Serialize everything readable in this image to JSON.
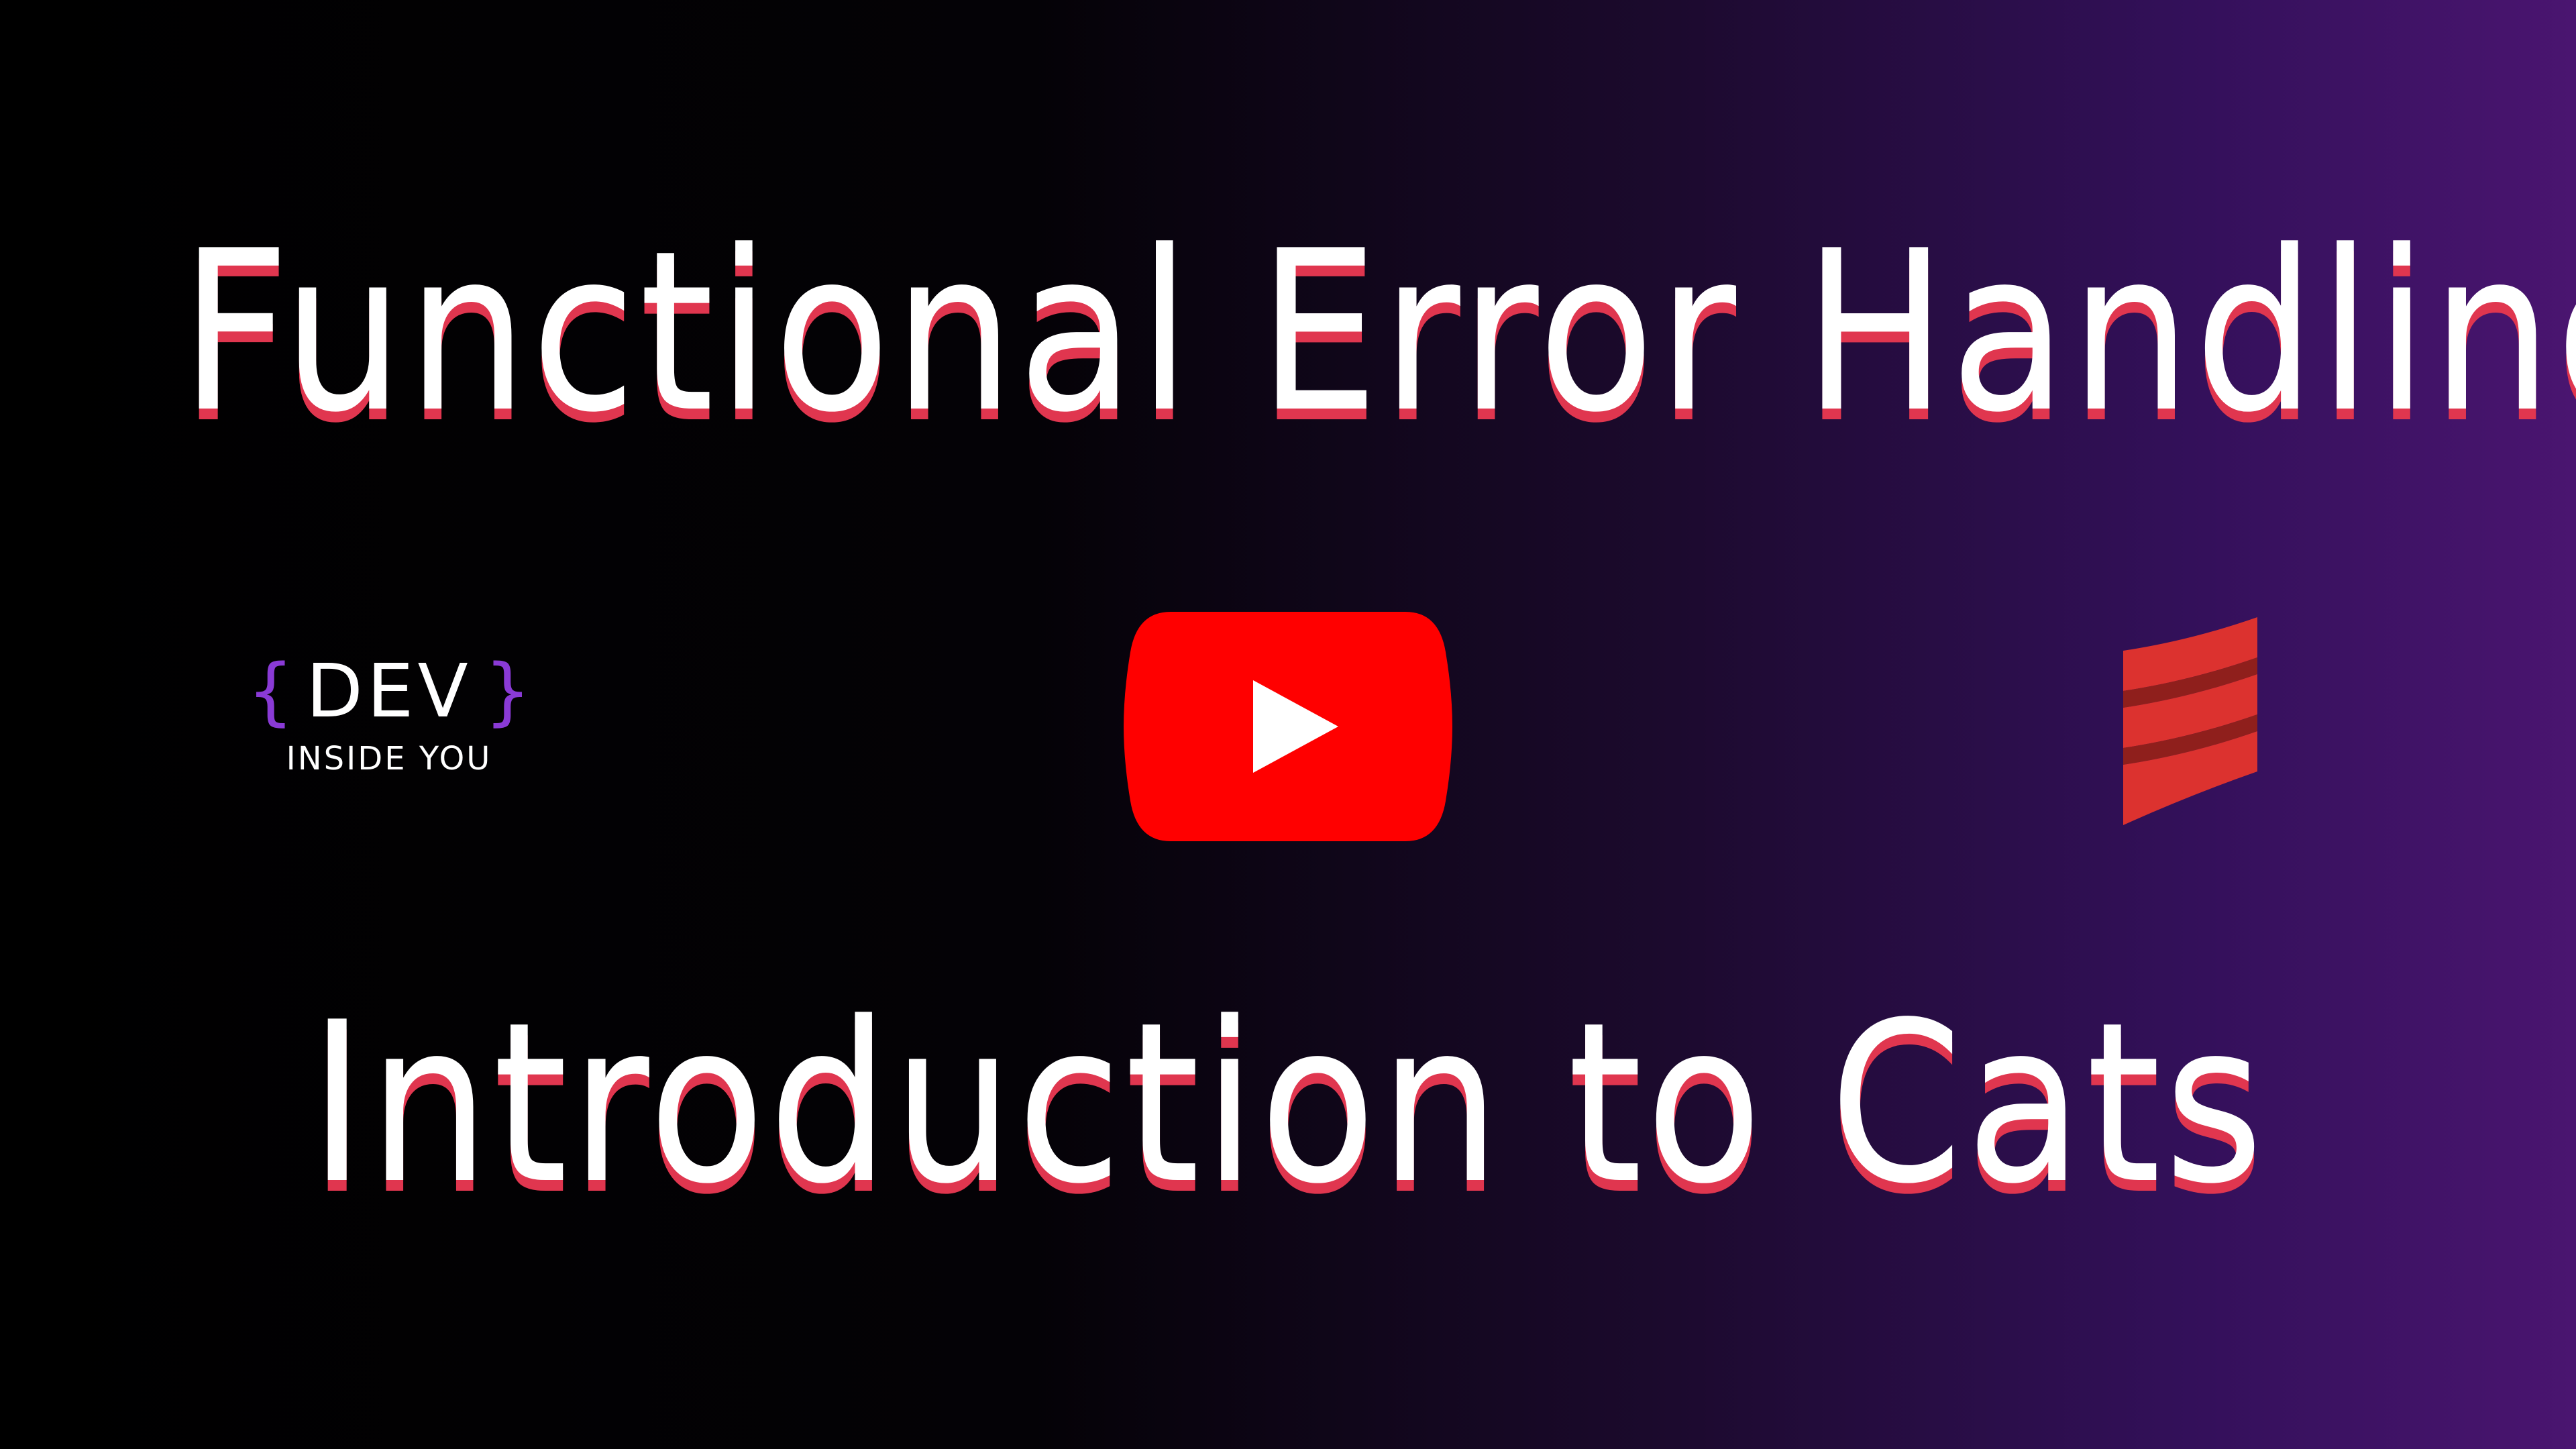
{
  "title": {
    "line1": "Functional Error Handling",
    "line2": "Introduction to Cats"
  },
  "dev_logo": {
    "open_brace": "{",
    "name": "DEV",
    "close_brace": "}",
    "tagline": "INSIDE YOU"
  },
  "icons": {
    "center": "youtube-play-icon",
    "right": "scala-logo-icon"
  },
  "colors": {
    "title_text": "#ffffff",
    "title_shadow": "#e0364f",
    "brace_accent": "#8a3ad6",
    "youtube_red": "#ff0000",
    "scala_red": "#dc322f",
    "background_left": "#000000",
    "background_right": "#4a1570"
  }
}
